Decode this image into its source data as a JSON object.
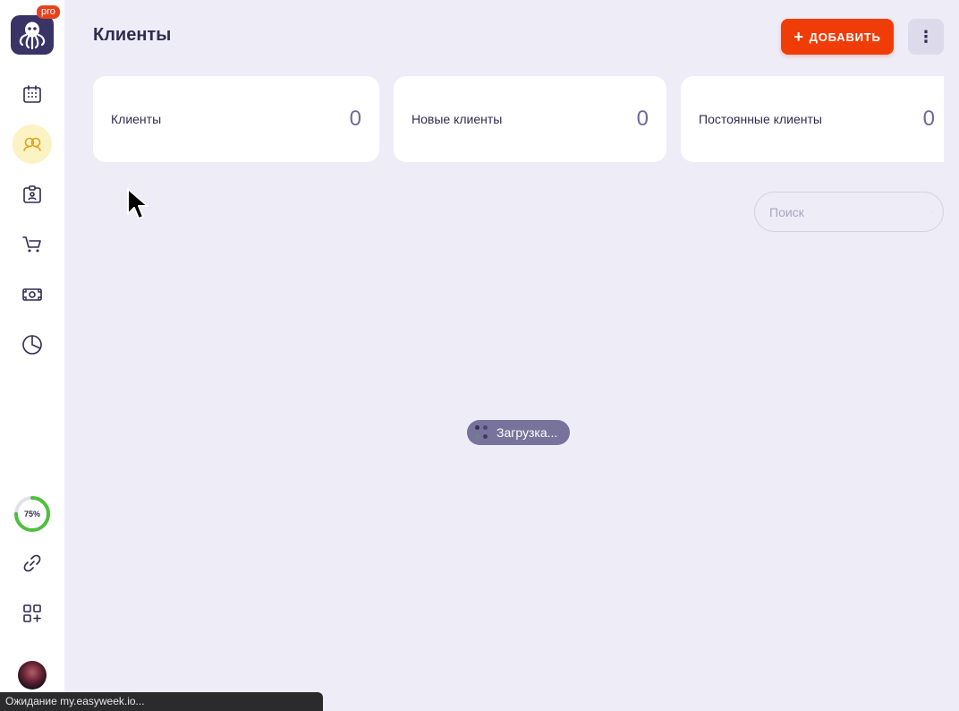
{
  "app": {
    "badge": "pro",
    "title": "Клиенты",
    "add_button_label": "ДОБАВИТЬ",
    "add_button_icon": "+",
    "more_button_icon": "⋮"
  },
  "sidebar": {
    "items": [
      {
        "name": "calendar",
        "active": false
      },
      {
        "name": "clients",
        "active": true
      },
      {
        "name": "services",
        "active": false
      },
      {
        "name": "cart",
        "active": false
      },
      {
        "name": "payments",
        "active": false
      },
      {
        "name": "reports",
        "active": false
      }
    ],
    "setup_progress": 75,
    "setup_progress_label": "75%",
    "bottom_items": [
      {
        "name": "link"
      },
      {
        "name": "add-widget"
      }
    ]
  },
  "stats": [
    {
      "label": "Клиенты",
      "value": "0"
    },
    {
      "label": "Новые клиенты",
      "value": "0"
    },
    {
      "label": "Постоянные клиенты",
      "value": "0"
    }
  ],
  "search": {
    "placeholder": "Поиск",
    "value": ""
  },
  "loading_text": "Загрузка...",
  "status_bar_text": "Ожидание my.easyweek.io...",
  "colors": {
    "accent": "#f03d07",
    "background": "#eeecf7",
    "primary_text": "#2f2c52",
    "active_nav": "#fbf3c4",
    "progress_green": "#4fbf3f"
  }
}
